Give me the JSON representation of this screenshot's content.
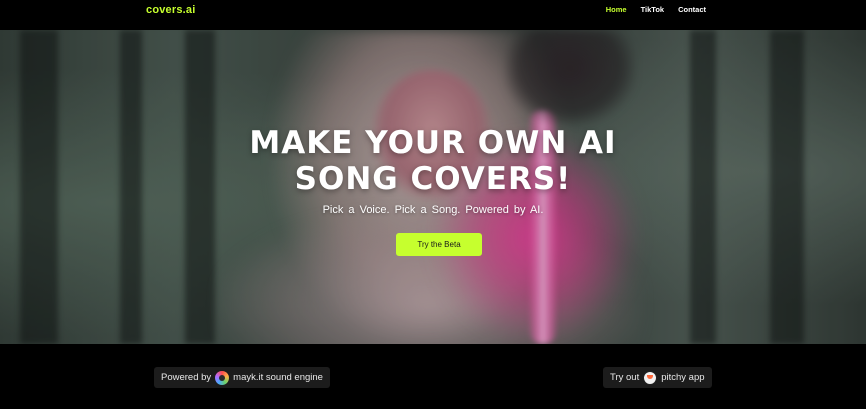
{
  "nav": {
    "brand": "covers.ai",
    "links": [
      {
        "label": "Home",
        "active": true
      },
      {
        "label": "TikTok",
        "active": false
      },
      {
        "label": "Contact",
        "active": false
      }
    ]
  },
  "hero": {
    "headline_line1": "MAKE YOUR OWN AI",
    "headline_line2": "SONG COVERS!",
    "subheadline": "Pick a Voice.  Pick a Song.  Powered by AI.",
    "cta_label": "Try the Beta"
  },
  "footer": {
    "left_prefix": "Powered by",
    "left_label": "mayk.it sound engine",
    "left_icon": "mayk-logo-icon",
    "right_prefix": "Try out",
    "right_label": "pitchy app",
    "right_icon": "pitchy-logo-icon"
  },
  "colors": {
    "accent": "#c6ff2e",
    "background": "#000000",
    "pill_background": "#1c1c1c"
  }
}
